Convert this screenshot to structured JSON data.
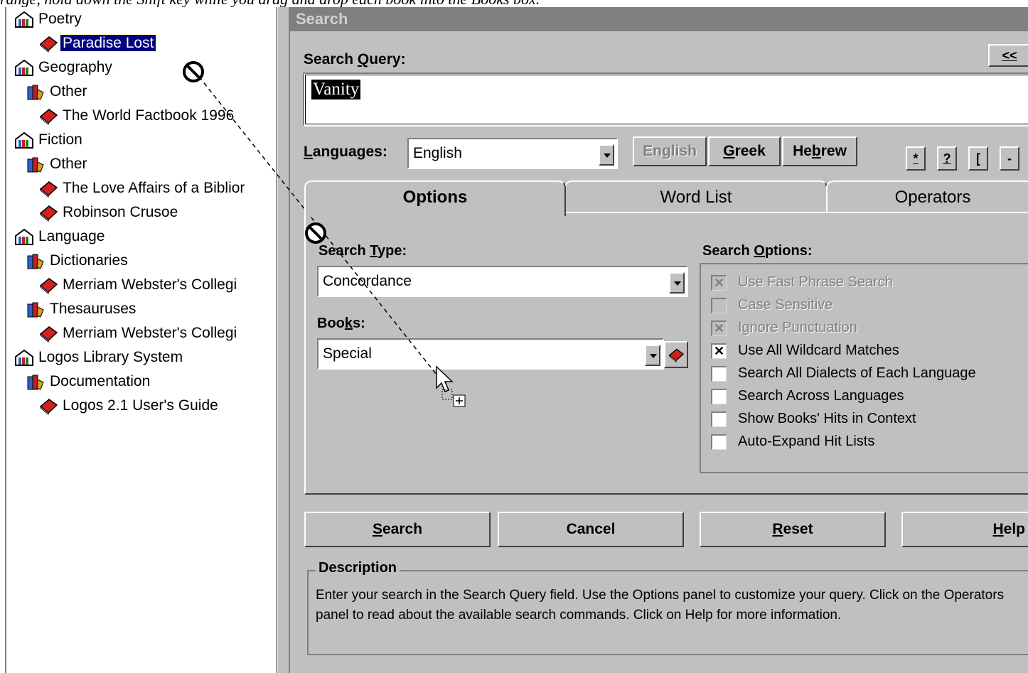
{
  "caption": "range, hold down the Shift key while you drag and drop each book into the Books box.",
  "tree": {
    "items": [
      {
        "label": "Poetry",
        "icon": "shelf-icon",
        "level": 0
      },
      {
        "label": "Paradise Lost",
        "icon": "book-icon",
        "level": 2,
        "selected": true
      },
      {
        "label": "Geography",
        "icon": "shelf-icon",
        "level": 0
      },
      {
        "label": "Other",
        "icon": "books-icon",
        "level": 1
      },
      {
        "label": "The World Factbook 1996",
        "icon": "book-icon",
        "level": 2
      },
      {
        "label": "Fiction",
        "icon": "shelf-icon",
        "level": 0
      },
      {
        "label": "Other",
        "icon": "books-icon",
        "level": 1
      },
      {
        "label": "The Love Affairs of a Biblior",
        "icon": "book-icon",
        "level": 2
      },
      {
        "label": "Robinson Crusoe",
        "icon": "book-icon",
        "level": 2
      },
      {
        "label": "Language",
        "icon": "shelf-icon",
        "level": 0
      },
      {
        "label": "Dictionaries",
        "icon": "books-icon",
        "level": 1
      },
      {
        "label": "Merriam Webster's Collegi",
        "icon": "book-icon",
        "level": 2
      },
      {
        "label": "Thesauruses",
        "icon": "books-icon",
        "level": 1
      },
      {
        "label": "Merriam Webster's Collegi",
        "icon": "book-icon",
        "level": 2
      },
      {
        "label": "Logos Library System",
        "icon": "shelf-icon",
        "level": 0
      },
      {
        "label": "Documentation",
        "icon": "books-icon",
        "level": 1
      },
      {
        "label": "Logos 2.1 User's Guide",
        "icon": "book-icon",
        "level": 2
      }
    ]
  },
  "panel": {
    "title": "Search",
    "query_label": "Search Query:",
    "query_value": "Vanity",
    "collapse_button": "<<",
    "languages_label": "Languages:",
    "language_selected": "English",
    "lang_buttons": [
      "English",
      "Greek",
      "Hebrew"
    ],
    "symbol_buttons": [
      "*",
      "?",
      "[",
      "-"
    ],
    "tabs": [
      "Options",
      "Word List",
      "Operators"
    ],
    "search_type_label": "Search Type:",
    "search_type_value": "Concordance",
    "books_label": "Books:",
    "books_value": "Special",
    "search_options_label": "Search Options:",
    "options": [
      {
        "label": "Use Fast Phrase Search",
        "checked": true,
        "disabled": true
      },
      {
        "label": "Case Sensitive",
        "checked": false,
        "disabled": true
      },
      {
        "label": "Ignore Punctuation",
        "checked": true,
        "disabled": true
      },
      {
        "label": "Use All Wildcard Matches",
        "checked": true,
        "disabled": false
      },
      {
        "label": "Search All Dialects of Each Language",
        "checked": false,
        "disabled": false
      },
      {
        "label": "Search Across Languages",
        "checked": false,
        "disabled": false
      },
      {
        "label": "Show Books' Hits in Context",
        "checked": false,
        "disabled": false
      },
      {
        "label": "Auto-Expand Hit Lists",
        "checked": false,
        "disabled": false
      }
    ],
    "actions": [
      "Search",
      "Cancel",
      "Reset",
      "Help"
    ],
    "description_label": "Description",
    "description_text": "Enter your search in the Search Query field. Use the Options panel to customize your query. Click on the Operators panel to read about the available search commands. Click on Help for more information."
  }
}
